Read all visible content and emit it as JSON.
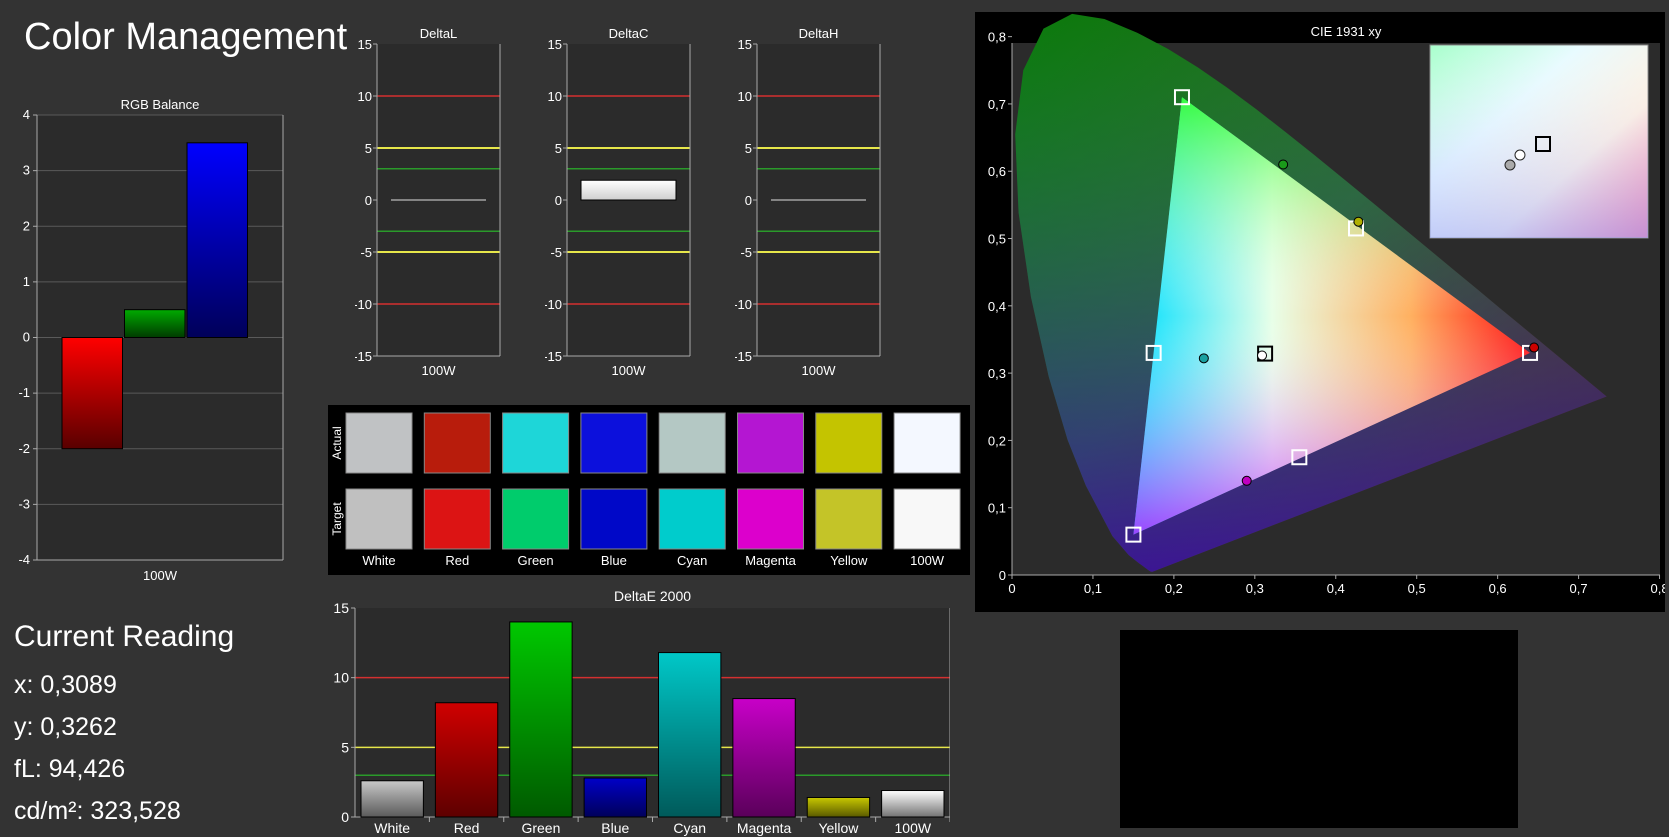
{
  "page_title": "Color Management",
  "current_reading": {
    "heading": "Current Reading",
    "x": "x: 0,3089",
    "y": "y: 0,3262",
    "fl": "fL: 94,426",
    "cdm2": "cd/m²: 323,528"
  },
  "colors": {
    "background": "#333333",
    "plot_background": "#2b2b2b",
    "threshold_red": "#d43030",
    "threshold_yellow": "#e6e64a",
    "threshold_green": "#2a9a2a"
  },
  "chart_data": [
    {
      "id": "rgb-balance",
      "type": "bar",
      "title": "RGB Balance",
      "categories": [
        "100W"
      ],
      "series": [
        {
          "color": "#ff0000",
          "values": [
            -2.0
          ]
        },
        {
          "color": "#00aa00",
          "values": [
            0.5
          ]
        },
        {
          "color": "#0000ff",
          "values": [
            3.5
          ]
        }
      ],
      "ylim": [
        -4,
        4
      ],
      "yticks": [
        "-4",
        "-3",
        "-2",
        "-1",
        "0",
        "1",
        "2",
        "3",
        "4"
      ],
      "grid": true
    },
    {
      "id": "delta-l",
      "type": "bar",
      "title": "DeltaL",
      "categories": [
        "100W"
      ],
      "values": [
        0.0
      ],
      "ylim": [
        -15,
        15
      ],
      "yticks": [
        "-15",
        "-10",
        "-5",
        "0",
        "5",
        "10",
        "15"
      ],
      "thresholds": [
        10,
        5,
        3,
        -3,
        -5,
        -10
      ]
    },
    {
      "id": "delta-c",
      "type": "bar",
      "title": "DeltaC",
      "categories": [
        "100W"
      ],
      "values": [
        1.9
      ],
      "ylim": [
        -15,
        15
      ],
      "yticks": [
        "-15",
        "-10",
        "-5",
        "0",
        "5",
        "10",
        "15"
      ],
      "thresholds": [
        10,
        5,
        3,
        -3,
        -5,
        -10
      ]
    },
    {
      "id": "delta-h",
      "type": "bar",
      "title": "DeltaH",
      "categories": [
        "100W"
      ],
      "values": [
        0.0
      ],
      "ylim": [
        -15,
        15
      ],
      "yticks": [
        "-15",
        "-10",
        "-5",
        "0",
        "5",
        "10",
        "15"
      ],
      "thresholds": [
        10,
        5,
        3,
        -3,
        -5,
        -10
      ]
    },
    {
      "id": "swatches",
      "type": "table",
      "row_labels": [
        "Actual",
        "Target"
      ],
      "columns": [
        "White",
        "Red",
        "Green",
        "Blue",
        "Cyan",
        "Magenta",
        "Yellow",
        "100W"
      ],
      "actual_colors": [
        "#c0c2c4",
        "#b81c0c",
        "#1ed6d8",
        "#0c10dc",
        "#b4c8c4",
        "#b416d2",
        "#c4c400",
        "#f4f8ff"
      ],
      "target_colors": [
        "#c0c0c0",
        "#dc1414",
        "#00cc6c",
        "#0008c8",
        "#00cccc",
        "#dc00cc",
        "#c4c428",
        "#f8f8f8"
      ]
    },
    {
      "id": "delta-e-2000",
      "type": "bar",
      "title": "DeltaE 2000",
      "categories": [
        "White",
        "Red",
        "Green",
        "Blue",
        "Cyan",
        "Magenta",
        "Yellow",
        "100W"
      ],
      "values": [
        2.6,
        8.2,
        14.0,
        2.8,
        11.8,
        8.5,
        1.4,
        1.9
      ],
      "colors": [
        "#c8c8c8",
        "#d00000",
        "#00c800",
        "#0000c8",
        "#00c8c8",
        "#c800c8",
        "#c8c800",
        "#ffffff"
      ],
      "ylim": [
        0,
        15
      ],
      "yticks": [
        "0",
        "5",
        "10",
        "15"
      ],
      "thresholds": [
        10,
        5,
        3
      ]
    },
    {
      "id": "cie-1931",
      "type": "scatter",
      "title": "CIE 1931 xy",
      "xlim": [
        0,
        0.85
      ],
      "ylim": [
        0,
        0.85
      ],
      "xticks": [
        "0",
        "0,1",
        "0,2",
        "0,3",
        "0,4",
        "0,5",
        "0,6",
        "0,7",
        "0,8"
      ],
      "yticks": [
        "0",
        "0,1",
        "0,2",
        "0,3",
        "0,4",
        "0,5",
        "0,6",
        "0,7",
        "0,8"
      ],
      "gamut_target": [
        [
          0.64,
          0.33
        ],
        [
          0.3,
          0.6
        ],
        [
          0.15,
          0.06
        ]
      ],
      "gamut_actual": [
        [
          0.21,
          0.71
        ],
        [
          0.64,
          0.33
        ],
        [
          0.15,
          0.06
        ]
      ],
      "targets": [
        {
          "name": "Red",
          "x": 0.64,
          "y": 0.33
        },
        {
          "name": "Green",
          "x": 0.21,
          "y": 0.71
        },
        {
          "name": "Blue",
          "x": 0.15,
          "y": 0.06
        },
        {
          "name": "Cyan",
          "x": 0.175,
          "y": 0.33
        },
        {
          "name": "Magenta",
          "x": 0.355,
          "y": 0.175
        },
        {
          "name": "Yellow",
          "x": 0.425,
          "y": 0.515
        },
        {
          "name": "White",
          "x": 0.3127,
          "y": 0.329
        }
      ],
      "measured": [
        {
          "name": "Red",
          "x": 0.645,
          "y": 0.338,
          "color": "#cc0000"
        },
        {
          "name": "Green",
          "x": 0.335,
          "y": 0.61,
          "color": "#1a9a1a"
        },
        {
          "name": "Yellow",
          "x": 0.428,
          "y": 0.525,
          "color": "#b0b000"
        },
        {
          "name": "Cyan",
          "x": 0.237,
          "y": 0.322,
          "color": "#1aa0a0"
        },
        {
          "name": "Magenta",
          "x": 0.29,
          "y": 0.14,
          "color": "#c000c0"
        },
        {
          "name": "White",
          "x": 0.3089,
          "y": 0.3262,
          "color": "#ffffff"
        }
      ],
      "inset_points": [
        {
          "type": "target",
          "color": "#000000"
        },
        {
          "type": "measured",
          "color": "#ffffff"
        },
        {
          "type": "measured",
          "color": "#aaaaaa"
        }
      ]
    }
  ]
}
